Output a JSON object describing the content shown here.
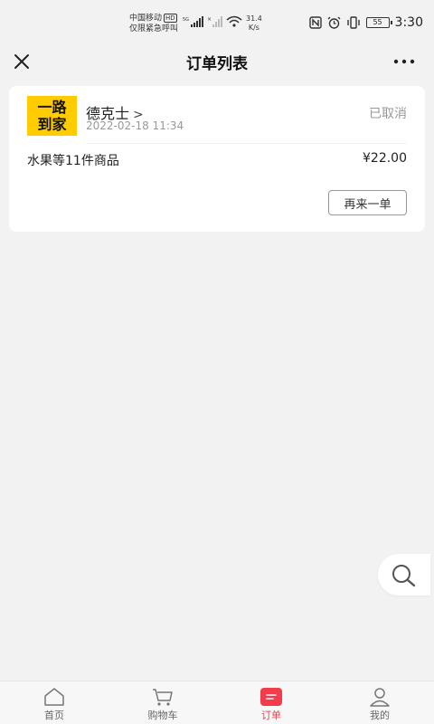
{
  "status_bar": {
    "carrier_line1": "中国移动",
    "carrier_badge": "HD",
    "carrier_line2": "仅限紧急呼叫",
    "net_speed_value": "31.4",
    "net_speed_unit": "K/s",
    "battery": "55",
    "time": "3:30"
  },
  "nav": {
    "title": "订单列表"
  },
  "order": {
    "logo_line1": "一路",
    "logo_line2": "到家",
    "store_name": "德克士",
    "store_chevron": ">",
    "time": "2022-02-18 11:34",
    "status": "已取消",
    "items_summary": "水果等11件商品",
    "price": "¥22.00",
    "reorder_label": "再来一单"
  },
  "tabs": [
    {
      "label": "首页",
      "icon": "home-icon",
      "active": false
    },
    {
      "label": "购物车",
      "icon": "cart-icon",
      "active": false
    },
    {
      "label": "订单",
      "icon": "order-icon",
      "active": true
    },
    {
      "label": "我的",
      "icon": "profile-icon",
      "active": false
    }
  ],
  "colors": {
    "accent": "#f23b4b",
    "brand_yellow": "#ffcc00",
    "background": "#f2f2f2"
  }
}
